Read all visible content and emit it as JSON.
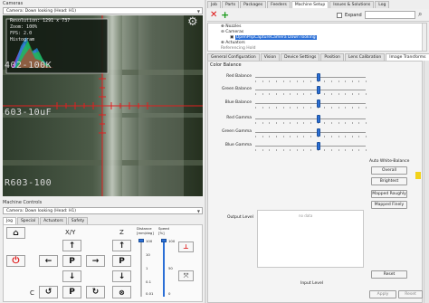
{
  "cameras_panel": {
    "title": "Cameras",
    "camera_select": "Camera: Down looking (Head: H1)",
    "overlay": {
      "resolution": "Resolution:  1291 x 737",
      "zoom": "Zoom: 100%",
      "fps": "FPS: 2.0",
      "histogram": "Histogram"
    },
    "pcb_labels": [
      "402-100K",
      "603-10uF",
      "R603-100"
    ]
  },
  "machine_controls": {
    "title": "Machine Controls",
    "camera_select": "Camera: Down looking (Head: H1)",
    "tabs": [
      "Jog",
      "Special",
      "Actuators",
      "Safety"
    ],
    "xy_label": "X/Y",
    "z_label": "Z",
    "c_label": "C",
    "distance_label": "Distance\n[mm/deg]",
    "distance_value": "100",
    "speed_label": "Speed\n[%]",
    "speed_value": "100",
    "ticks": [
      "10",
      "1",
      "0.1",
      "0.01"
    ],
    "speed_ticks": [
      "100",
      "50",
      "0"
    ],
    "park_label": "P",
    "arrow_left": "←",
    "arrow_right": "→",
    "arrow_up": "↑",
    "arrow_down": "↓",
    "home_icon": "house-icon"
  },
  "top_tabs": [
    "Job",
    "Parts",
    "Packages",
    "Feeders",
    "Machine Setup",
    "Issues & Solutions",
    "Log"
  ],
  "top_tabs_active": "Machine Setup",
  "machine_setup": {
    "expand_label": "Expand",
    "search_placeholder": "Search",
    "tree": [
      "Nozzles",
      "Cameras",
      "OpenPnpCaptureCamera Down looking",
      "Actuators",
      "Referencing Hold"
    ],
    "tabs": [
      "General Configuration",
      "Vision",
      "Device Settings",
      "Position",
      "Lens Calibration",
      "Image Transforms"
    ],
    "active_tab": "Image Transforms",
    "section": "Color Balance",
    "sliders": [
      {
        "label": "Red Balance",
        "value": 0.57
      },
      {
        "label": "Green Balance",
        "value": 0.57
      },
      {
        "label": "Blue Balance",
        "value": 0.57
      },
      {
        "label": "Red Gamma",
        "value": 0.57
      },
      {
        "label": "Green Gamma",
        "value": 0.57
      },
      {
        "label": "Blue Gamma",
        "value": 0.57
      }
    ],
    "auto_white_balance": "Auto White-Balance",
    "awb_buttons": [
      "Overall",
      "Brightest",
      "Mapped Roughly",
      "Mapped Finely"
    ],
    "output_level": "Output Level",
    "no_data": "no data",
    "reset": "Reset",
    "input_level": "Input Level",
    "apply": "Apply",
    "reset_bottom": "Reset"
  },
  "colors": {
    "accent": "#2b6fd6",
    "remove_red": "#d11",
    "add_green": "#1a9a1a",
    "power_red": "#d11"
  }
}
